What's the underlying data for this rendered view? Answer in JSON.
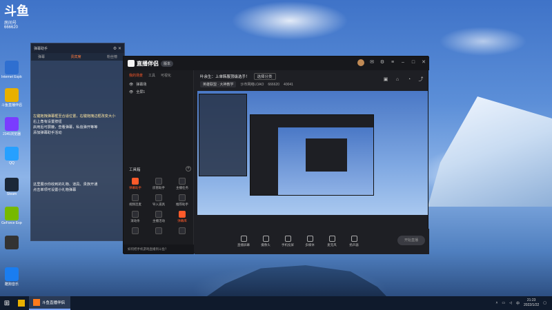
{
  "desktop": {
    "icons": [
      {
        "label": "斗鱼直播",
        "color": "#2a7de1"
      },
      {
        "label": "Internet Explorer",
        "color": "#2f6fd0"
      },
      {
        "label": "斗鱼直播伴侣",
        "color": "#e8b000"
      },
      {
        "label": "2345浏览器",
        "color": "#7a3cff"
      },
      {
        "label": "QQ",
        "color": "#26a0ff"
      },
      {
        "label": "Steam",
        "color": "#1b2838"
      },
      {
        "label": "GeForce Experience",
        "color": "#76b900"
      },
      {
        "label": "",
        "color": "#333"
      },
      {
        "label": "酷狗音乐",
        "color": "#1a7df0"
      }
    ],
    "top_left_logo": "斗鱼",
    "top_left_sub": "房间号",
    "top_left_num": "666620"
  },
  "left_panel": {
    "top_title": "弹幕助手",
    "tabs": [
      "弹幕",
      "贵宾席",
      "粉丝榜"
    ],
    "hint_red": "左键拖拽弹幕框到合适位置，右键拖拽边框改变大小",
    "hint_red2": "右上角有设置按钮",
    "line1": "左键拖拽弹幕框至合适位置，右键拖拽边框改变大小",
    "line2": "右上角有设置按钮",
    "line3": "启用后可屏蔽，查看弹幕，私信弹开等等",
    "line4": "添加弹幕助手活动",
    "line5": "这里展示你收到的礼物、道具、贵族开通",
    "line6": "点击单项可设置小礼物弹幕"
  },
  "app": {
    "title": "直播伴侣",
    "version": "版本",
    "side_tabs": [
      "我的场景",
      "工具",
      "可视化"
    ],
    "scenes": [
      "弹幕场",
      "全屏1"
    ],
    "tools_title": "工具箱",
    "tools": [
      {
        "label": "弹幕助手",
        "red": true
      },
      {
        "label": "房管助手",
        "red": false
      },
      {
        "label": "主播任务",
        "red": false
      },
      {
        "label": "视频连麦",
        "red": false
      },
      {
        "label": "导入道具",
        "red": false
      },
      {
        "label": "推荐助手",
        "red": false
      },
      {
        "label": "滚动条",
        "red": false
      },
      {
        "label": "主播活动",
        "red": false
      },
      {
        "label": "弹幕库",
        "red": true
      },
      {
        "label": "",
        "red": false
      },
      {
        "label": "",
        "red": false
      },
      {
        "label": "",
        "red": false
      }
    ],
    "footer": "如何把手机游戏直播到斗鱼？",
    "room_title": "叶余生：上单韩服顶级选手！",
    "room_edit": "选择分类",
    "meta_category": "英雄联盟 · 大神教学",
    "meta_room": "沙市网络LOAO",
    "meta_id": "666620",
    "meta_viewers": "40041",
    "bottom": [
      "直播屏幕",
      "摄像头",
      "手机投屏",
      "多媒体",
      "麦克风",
      "扬声器"
    ],
    "start_label": "开始直播"
  },
  "taskbar": {
    "app_label": "斗鱼直播伴侣",
    "time": "21:23",
    "date": "2022/1/22",
    "lang": "中"
  }
}
